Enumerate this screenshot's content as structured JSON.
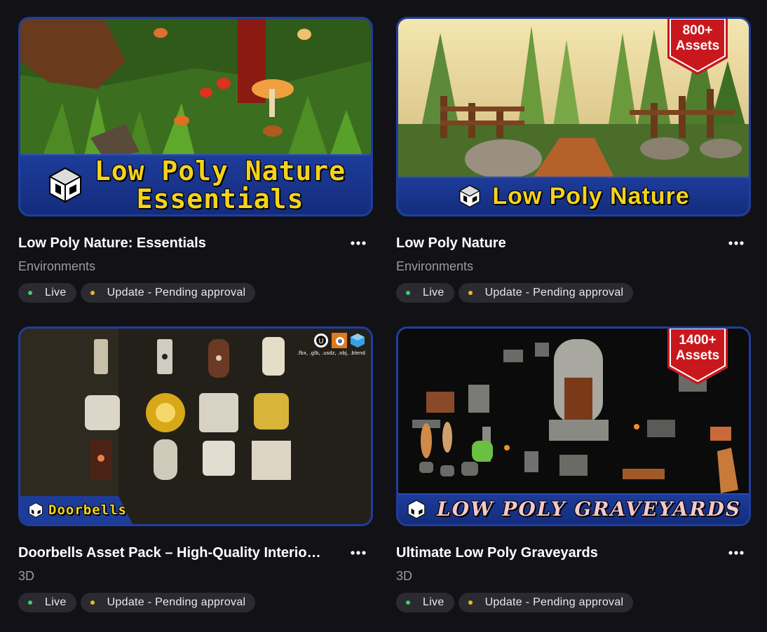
{
  "colors": {
    "background": "#121216",
    "card_border": "#1f3e9e",
    "banner_blue": "#1d3c9a",
    "banner_yellow": "#f5d21c",
    "badge_bg": "#2a2a30",
    "live_dot": "#3dcf6a",
    "pending_dot": "#f0b429",
    "ribbon_red": "#c8181e",
    "category_text": "#9a9aa2"
  },
  "more_icon": "more-horizontal-icon",
  "cards": [
    {
      "title": "Low Poly Nature: Essentials",
      "category": "Environments",
      "badges": [
        {
          "label": "Live",
          "status": "live"
        },
        {
          "label": "Update - Pending approval",
          "status": "pending"
        }
      ],
      "banner_line1": "Low Poly Nature",
      "banner_line2": "Essentials",
      "ribbon": null
    },
    {
      "title": "Low Poly Nature",
      "category": "Environments",
      "badges": [
        {
          "label": "Live",
          "status": "live"
        },
        {
          "label": "Update - Pending approval",
          "status": "pending"
        }
      ],
      "banner_line1": "Low Poly Nature",
      "ribbon_line1": "800+",
      "ribbon_line2": "Assets"
    },
    {
      "title": "Doorbells Asset Pack – High-Quality Interior Props",
      "category": "3D",
      "badges": [
        {
          "label": "Live",
          "status": "live"
        },
        {
          "label": "Update - Pending approval",
          "status": "pending"
        }
      ],
      "banner_line1": "Doorbells",
      "formats": ".fbx, .glb, .usdz, .obj, .blend"
    },
    {
      "title": "Ultimate Low Poly Graveyards",
      "category": "3D",
      "badges": [
        {
          "label": "Live",
          "status": "live"
        },
        {
          "label": "Update - Pending approval",
          "status": "pending"
        }
      ],
      "banner_line1": "LOW POLY GRAVEYARDS",
      "ribbon_line1": "1400+",
      "ribbon_line2": "Assets"
    }
  ]
}
